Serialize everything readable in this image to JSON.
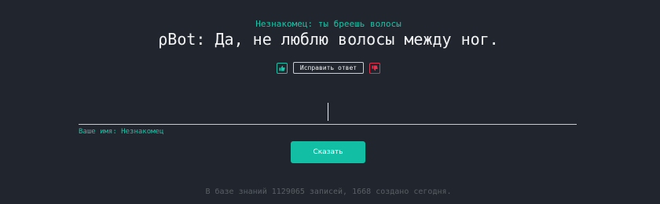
{
  "conversation": {
    "user_message": "Незнакомец: ты бреешь волосы",
    "bot_reply": "ρBot: Да, не люблю волосы между ног."
  },
  "feedback": {
    "like_icon": "thumbs-up-icon",
    "dislike_icon": "thumbs-down-icon",
    "fix_label": "Исправить ответ",
    "colors": {
      "like": "#1fc2a8",
      "dislike": "#e0334e"
    }
  },
  "input": {
    "value": "",
    "name_label": "Ваше имя: Незнакомец"
  },
  "actions": {
    "say_label": "Сказать"
  },
  "footer": {
    "stats": "В базе знаний 1129065 записей, 1668 создано сегодня."
  },
  "theme": {
    "background": "#21252d",
    "accent": "#12bfa5"
  }
}
